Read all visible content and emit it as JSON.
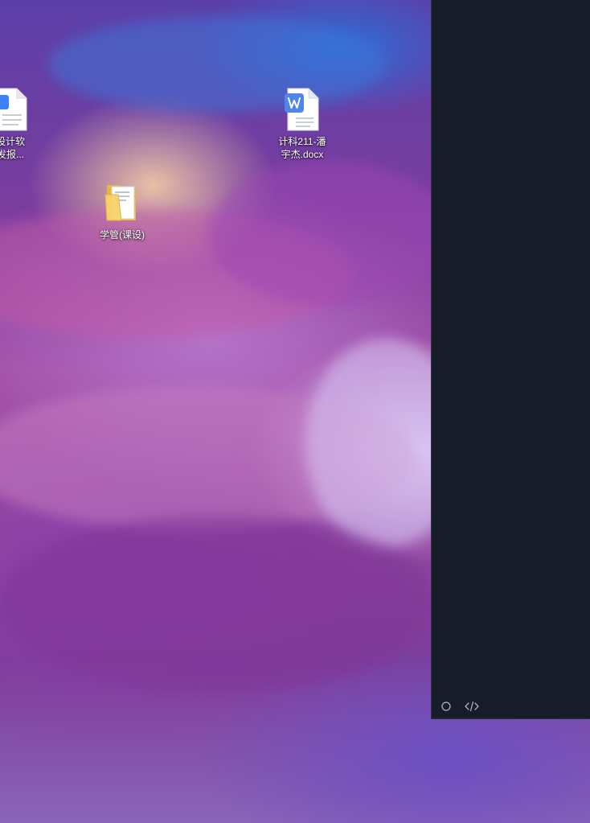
{
  "desktop": {
    "wallpaper": "purple-abstract-landscape",
    "icons": [
      {
        "label_line1": "设计软",
        "label_line2": "发报...",
        "type": "word-document",
        "accent": "#3b82f6"
      },
      {
        "label_line1": "计科211-潘",
        "label_line2": "宇杰.docx",
        "type": "word-document",
        "accent": "#4f86ec"
      },
      {
        "label_line1": "学管(课设)",
        "label_line2": "",
        "type": "folder",
        "accent": "#f4c542"
      }
    ]
  },
  "side_panel": {
    "background": "#161d29",
    "footer": {
      "circle_icon": "circle-icon",
      "code_icon": "code-icon"
    }
  }
}
